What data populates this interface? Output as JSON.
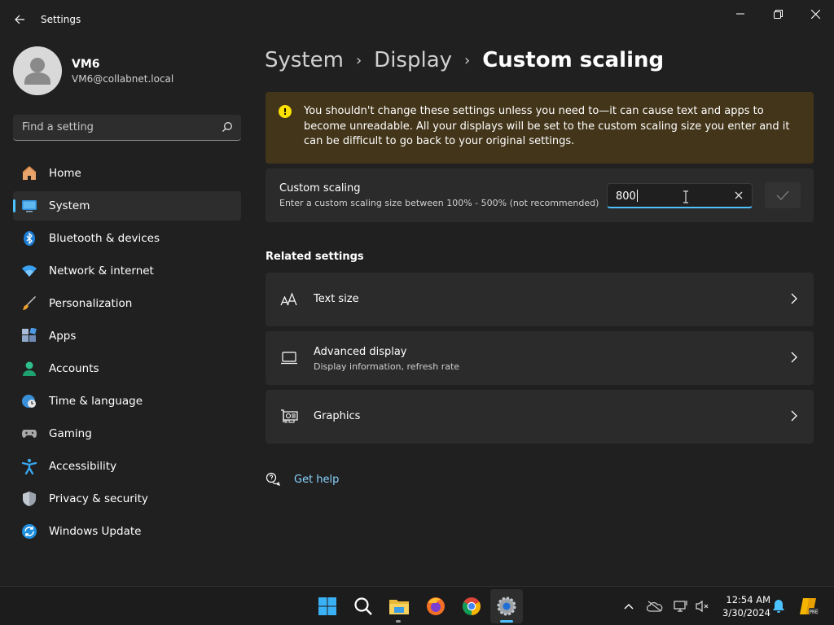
{
  "window": {
    "title": "Settings"
  },
  "profile": {
    "name": "VM6",
    "email": "VM6@collabnet.local"
  },
  "search": {
    "placeholder": "Find a setting"
  },
  "sidebar": {
    "items": [
      {
        "label": "Home",
        "icon": "home-icon"
      },
      {
        "label": "System",
        "icon": "system-icon",
        "active": true
      },
      {
        "label": "Bluetooth & devices",
        "icon": "bluetooth-icon"
      },
      {
        "label": "Network & internet",
        "icon": "network-icon"
      },
      {
        "label": "Personalization",
        "icon": "brush-icon"
      },
      {
        "label": "Apps",
        "icon": "apps-icon"
      },
      {
        "label": "Accounts",
        "icon": "accounts-icon"
      },
      {
        "label": "Time & language",
        "icon": "globe-clock-icon"
      },
      {
        "label": "Gaming",
        "icon": "gamepad-icon"
      },
      {
        "label": "Accessibility",
        "icon": "accessibility-icon"
      },
      {
        "label": "Privacy & security",
        "icon": "shield-icon"
      },
      {
        "label": "Windows Update",
        "icon": "update-icon"
      }
    ]
  },
  "breadcrumb": {
    "level1": "System",
    "level2": "Display",
    "current": "Custom scaling",
    "separator": "›"
  },
  "warning": {
    "text": "You shouldn't change these settings unless you need to—it can cause text and apps to become unreadable. All your displays will be set to the custom scaling size you enter and it can be difficult to go back to your original settings."
  },
  "custom_scaling": {
    "title": "Custom scaling",
    "description": "Enter a custom scaling size between 100% - 500% (not recommended)",
    "value": "800"
  },
  "related": {
    "heading": "Related settings",
    "items": [
      {
        "title": "Text size",
        "description": "",
        "icon": "text-size-icon"
      },
      {
        "title": "Advanced display",
        "description": "Display information, refresh rate",
        "icon": "monitor-icon"
      },
      {
        "title": "Graphics",
        "description": "",
        "icon": "graphics-card-icon"
      }
    ]
  },
  "help": {
    "label": "Get help"
  },
  "taskbar": {
    "clock_time": "12:54 AM",
    "clock_date": "3/30/2024",
    "pinned": [
      "windows-start-icon",
      "search-icon",
      "file-explorer-icon",
      "firefox-icon",
      "chrome-icon",
      "settings-icon"
    ]
  },
  "colors": {
    "accent": "#4cc2ff",
    "warning_bg": "#433519",
    "warning_icon": "#fce100",
    "link": "#8ad3ff"
  }
}
